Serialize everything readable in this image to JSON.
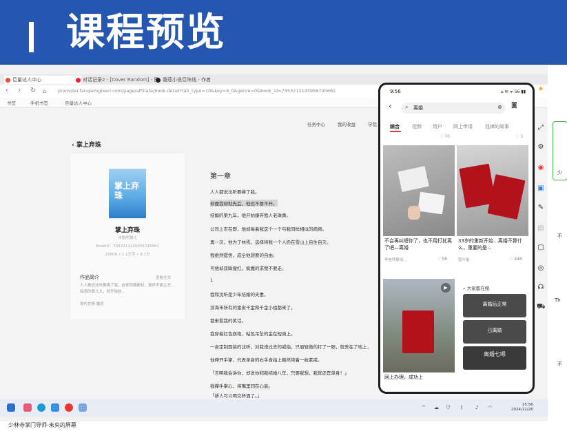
{
  "banner": {
    "title": "课程预览"
  },
  "browser": {
    "tabs": [
      {
        "label": "巨量达人中心",
        "color": "#f04a3a"
      },
      {
        "label": "对话记录2 - [Cover Random] - 图片",
        "color": "#e23"
      },
      {
        "label": "番茄小说巨阵线 - 作者",
        "color": "#222"
      }
    ],
    "url": "promoter.fanqiemgreen.com/page/affiliate/book-detail?tab_type=10&key=8_0&genre=0&book_id=7353212145956745662",
    "bookmarks": [
      "书签",
      "手机书签",
      "巨量达人中心"
    ]
  },
  "page": {
    "nav": [
      "任务中心",
      "我的收益",
      "学院"
    ],
    "back_label": "掌上弃珠",
    "book": {
      "cover_title": "掌上弃珠",
      "name": "掌上弃珠",
      "author": "洋胶的猫儿",
      "book_id": "BookID：7353212145956745662",
      "stats": "25606 • 1.1万字 • 8.1分",
      "intro_heading": "作品简介",
      "intro_more": "查看全文",
      "intro_text": "人人都说沈听要捧了我。前辈同期都知，我怀不更主无...综观的罪儿大，他开始娃...",
      "tags": "现代言情   婚恋"
    },
    "chapter_title": "第一章",
    "lines": [
      "人人都说沈听要捧了我。",
      "却便我却就先后，他也不要不开。",
      "结婚的第九年，他开始嫌弃我人老珠黄。",
      "公司上市在即，他却每着我这个一个与我同样相似的病频。",
      "再一次，他为了林焉，选择将我一个人扔在雪山上自生自灭。",
      "我绝然提悟，成全他想要的自由。",
      "可他却双眸猩红，疯魔的求我不要走。",
      "1",
      "我和沈听是少年结婚的夫妻，",
      "滨海市所有的富家千金和千金小姐都来了。",
      "都来看我的笑话。",
      "我穿着红色旗袍，粘色吊坠的金在短骑上。",
      "一身定制西装的沈听，对我递过去的戒指，只眉轻微的打了一眼，就丢在了地上，",
      "他伸开手掌，代表单身的右手食指上赫然带着一枚素戒。",
      "「言明我会讲你，却说你和我结婚八年，只要我想，我就还是单身！」",
      "我撑手掌心，将嘴里同在心底。",
      "「新人可以喝交杯酒了。」"
    ]
  },
  "phone": {
    "time": "9:56",
    "status_icons": "⌂ ✉ ᯤ 56 ▮▮",
    "search_query": "离婚",
    "tabs": [
      "综合",
      "视频",
      "用户",
      "网上申请",
      "找律的故事"
    ],
    "meta_left": "♡ 70",
    "meta_right": "♡ 3",
    "cards": [
      {
        "title": "不会再纠缠你了，也不用打扰离了吧—离婚",
        "user": "李老师聊母...",
        "likes": "♡ 58"
      },
      {
        "title": "33岁的重新开始…离婚不算什么，重要的是...",
        "user": "蓝叶屋",
        "likes": "♡ 446"
      },
      {
        "title": "网上办理，成功上",
        "user": "",
        "likes": ""
      }
    ],
    "recommend_heading": "大家都在搜",
    "recommend": [
      "离婚后正常",
      "已离婚",
      "离婚七嗯"
    ]
  },
  "edge": {
    "labels": [
      "少",
      "不",
      "Th",
      "不"
    ]
  },
  "taskbar": {
    "time": "15:56",
    "date": "2024/12/26"
  },
  "footer": "少林寺掌门导师-未央的屏幕",
  "colors": {
    "banner": "#2556b0",
    "accent": "#e33333",
    "red_book": "#b3121c"
  }
}
